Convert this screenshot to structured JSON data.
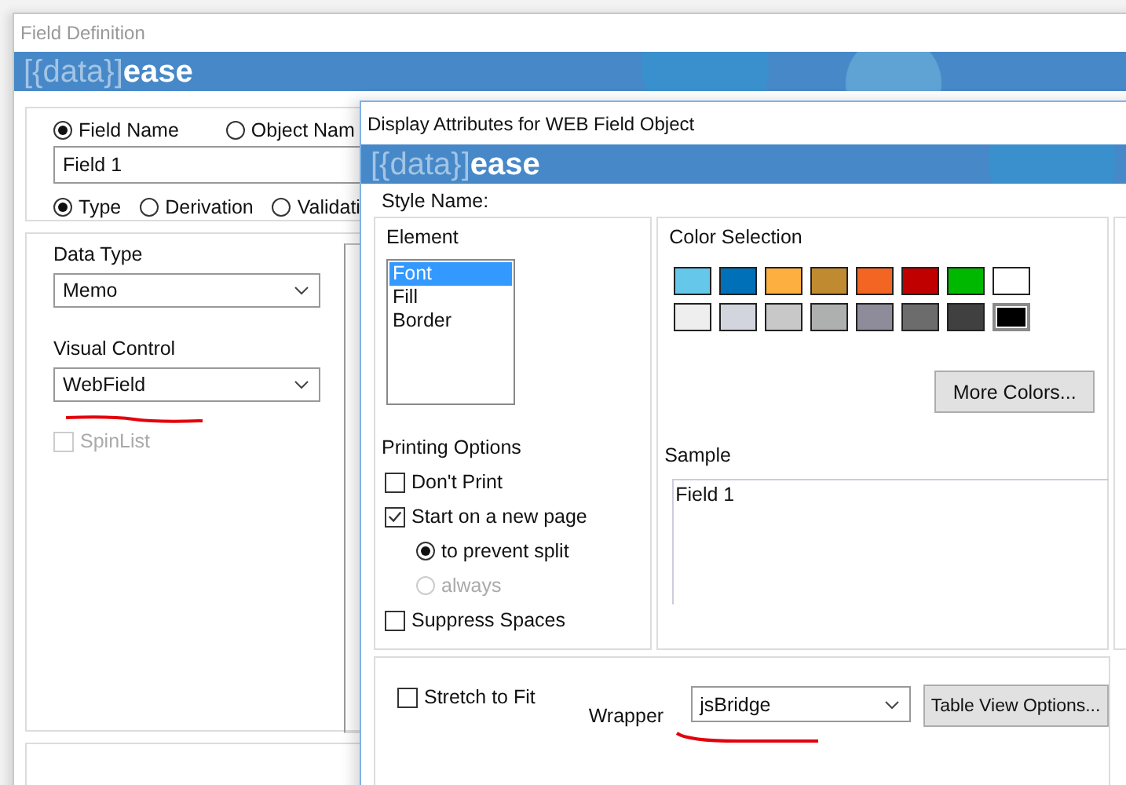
{
  "background_window": {
    "title": "Field Definition",
    "logo_bracket": "[{data}]",
    "logo_word": "ease",
    "name_options": [
      {
        "label": "Field Name",
        "selected": true
      },
      {
        "label": "Object Nam",
        "selected": false
      }
    ],
    "name_value": "Field 1",
    "mode_options": [
      {
        "label": "Type",
        "selected": true
      },
      {
        "label": "Derivation",
        "selected": false
      },
      {
        "label": "Validati",
        "selected": false
      }
    ],
    "data_type": {
      "label": "Data Type",
      "value": "Memo"
    },
    "visual_control": {
      "label": "Visual Control",
      "value": "WebField"
    },
    "spinlist": {
      "label": "SpinList",
      "checked": false,
      "disabled": true
    }
  },
  "dialog": {
    "title": "Display Attributes for WEB Field Object",
    "logo_bracket": "[{data}]",
    "logo_word": "ease",
    "style_name_label": "Style Name:",
    "element": {
      "label": "Element",
      "items": [
        {
          "label": "Font",
          "selected": true
        },
        {
          "label": "Fill",
          "selected": false
        },
        {
          "label": "Border",
          "selected": false
        }
      ]
    },
    "color_selection": {
      "label": "Color Selection",
      "swatches": [
        {
          "color": "#65c8ea",
          "selected": false
        },
        {
          "color": "#0070b8",
          "selected": false
        },
        {
          "color": "#fdb040",
          "selected": false
        },
        {
          "color": "#c08a30",
          "selected": false
        },
        {
          "color": "#f26522",
          "selected": false
        },
        {
          "color": "#c00000",
          "selected": false
        },
        {
          "color": "#00b800",
          "selected": false
        },
        {
          "color": "#ffffff",
          "selected": false
        },
        {
          "color": "#eeeeee",
          "selected": false
        },
        {
          "color": "#d2d5de",
          "selected": false
        },
        {
          "color": "#c8c8c8",
          "selected": false
        },
        {
          "color": "#aeb0b0",
          "selected": false
        },
        {
          "color": "#8e8c9a",
          "selected": false
        },
        {
          "color": "#6c6c6c",
          "selected": false
        },
        {
          "color": "#404040",
          "selected": false
        },
        {
          "color": "#000000",
          "selected": true
        }
      ],
      "more_button": "More Colors..."
    },
    "printing_options": {
      "label": "Printing Options",
      "options": [
        {
          "kind": "checkbox",
          "label": "Don't Print",
          "checked": false,
          "disabled": false
        },
        {
          "kind": "checkbox",
          "label": "Start on a new page",
          "checked": true,
          "disabled": false
        },
        {
          "kind": "radio",
          "label": "to prevent split",
          "selected": true,
          "disabled": false
        },
        {
          "kind": "radio",
          "label": "always",
          "selected": false,
          "disabled": true
        },
        {
          "kind": "checkbox",
          "label": "Suppress Spaces",
          "checked": false,
          "disabled": false
        }
      ]
    },
    "sample": {
      "label": "Sample",
      "text": "Field 1"
    },
    "stretch": {
      "label": "Stretch to Fit",
      "checked": false
    },
    "wrapper": {
      "label": "Wrapper",
      "value": "jsBridge"
    },
    "table_button": "Table View Options..."
  }
}
